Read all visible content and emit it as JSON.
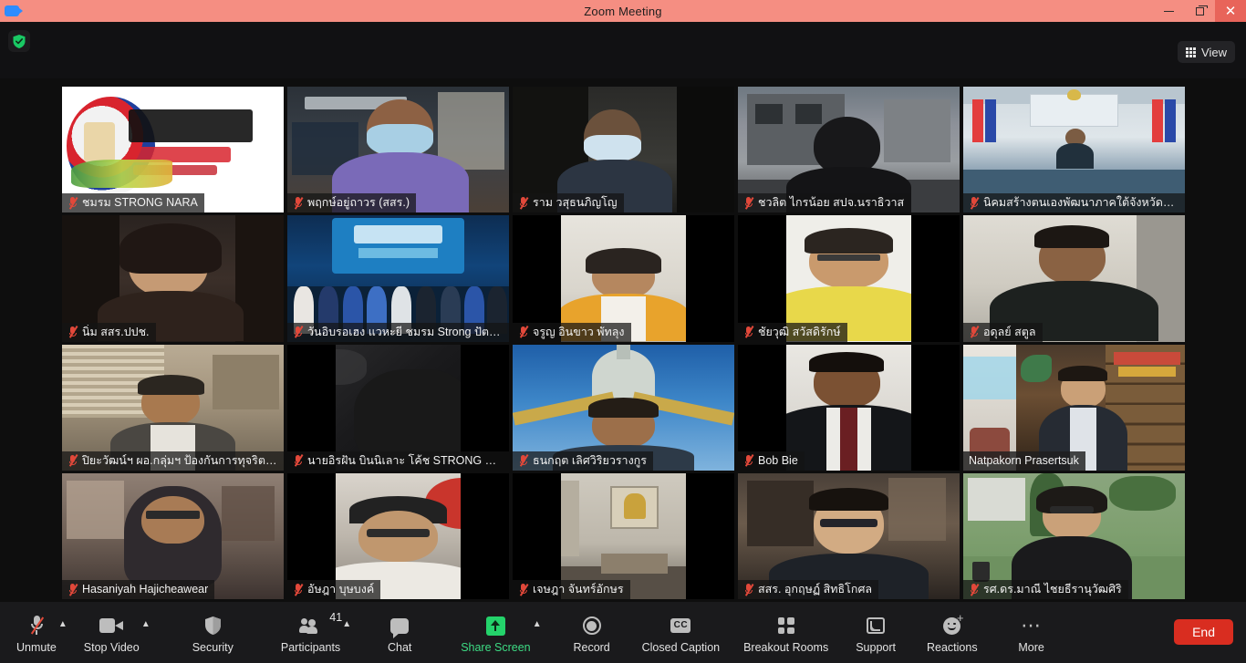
{
  "window": {
    "title": "Zoom Meeting",
    "app_icon": "zoom-camera-icon",
    "minimize_label": "Minimize",
    "maximize_label": "Restore",
    "close_label": "Close"
  },
  "header": {
    "security_icon": "green-shield-icon",
    "view_button": {
      "label": "View",
      "icon": "grid-view-icon"
    }
  },
  "gallery": {
    "columns": 5,
    "rows": 4,
    "active_speaker_border_color": "#d6e83c",
    "tiles": [
      {
        "name": "ชมรม STRONG NARA",
        "muted": true,
        "speaking": false
      },
      {
        "name": "พฤกษ์อยู่ถาวร (สสร.)",
        "muted": true,
        "speaking": false
      },
      {
        "name": "ราม วสุธนภิญโญ",
        "muted": true,
        "speaking": false
      },
      {
        "name": "ชวลิต ไกรน้อย สปจ.นราธิวาส",
        "muted": true,
        "speaking": false
      },
      {
        "name": "นิคมสร้างตนเองพัฒนาภาคใต้จังหวัดยะลา",
        "muted": true,
        "speaking": false
      },
      {
        "name": "นิ่ม สสร.ปปช.",
        "muted": true,
        "speaking": false
      },
      {
        "name": "วันอิบรอเฮง แวหะยี ชมรม Strong ปัตตานี",
        "muted": true,
        "speaking": false
      },
      {
        "name": "จรูญ อินขาว พัทลุง",
        "muted": true,
        "speaking": false
      },
      {
        "name": "ชัยวุฒิ สวัสดิรักษ์",
        "muted": true,
        "speaking": false
      },
      {
        "name": "อดุลย์ สตูล",
        "muted": true,
        "speaking": false
      },
      {
        "name": "ปิยะวัฒน์ฯ ผอ.กลุ่มฯ ป้องกันการทุจริตฯ ภ...",
        "muted": true,
        "speaking": false
      },
      {
        "name": "นายอิรฝัน บินนิเลาะ โค้ช STRONG Nara",
        "muted": true,
        "speaking": false
      },
      {
        "name": "ธนกฤต เลิศวิริยวรางกูร",
        "muted": true,
        "speaking": false
      },
      {
        "name": "Bob Bie",
        "muted": true,
        "speaking": false
      },
      {
        "name": "Natpakorn Prasertsuk",
        "muted": false,
        "speaking": true
      },
      {
        "name": "Hasaniyah Hajicheawear",
        "muted": true,
        "speaking": false
      },
      {
        "name": "อัษฎา บุษบงค์",
        "muted": true,
        "speaking": false
      },
      {
        "name": "เจษฎา จันทร์อักษร",
        "muted": true,
        "speaking": false
      },
      {
        "name": "สสร. อุกฤษฏ์ สิทธิโกศล",
        "muted": true,
        "speaking": false
      },
      {
        "name": "รศ.ดร.มาณี ไชยธีรานุวัฒศิริ",
        "muted": true,
        "speaking": false
      }
    ]
  },
  "toolbar": {
    "audio": {
      "label": "Unmute",
      "icon": "microphone-muted-icon",
      "has_menu": true
    },
    "video": {
      "label": "Stop Video",
      "icon": "camera-icon",
      "has_menu": true
    },
    "security": {
      "label": "Security",
      "icon": "shield-icon"
    },
    "participants": {
      "label": "Participants",
      "icon": "people-icon",
      "count": "41",
      "has_menu": true
    },
    "chat": {
      "label": "Chat",
      "icon": "chat-bubble-icon"
    },
    "share": {
      "label": "Share Screen",
      "icon": "share-screen-icon",
      "has_menu": true,
      "color": "#3ddc84"
    },
    "record": {
      "label": "Record",
      "icon": "record-circle-icon"
    },
    "closed_caption": {
      "label": "Closed Caption",
      "icon": "cc-icon"
    },
    "breakout": {
      "label": "Breakout Rooms",
      "icon": "breakout-rooms-icon"
    },
    "support": {
      "label": "Support",
      "icon": "support-cast-icon"
    },
    "reactions": {
      "label": "Reactions",
      "icon": "reactions-smiley-icon"
    },
    "more": {
      "label": "More",
      "icon": "more-dots-icon"
    },
    "end": {
      "label": "End",
      "color": "#d92d20"
    }
  }
}
